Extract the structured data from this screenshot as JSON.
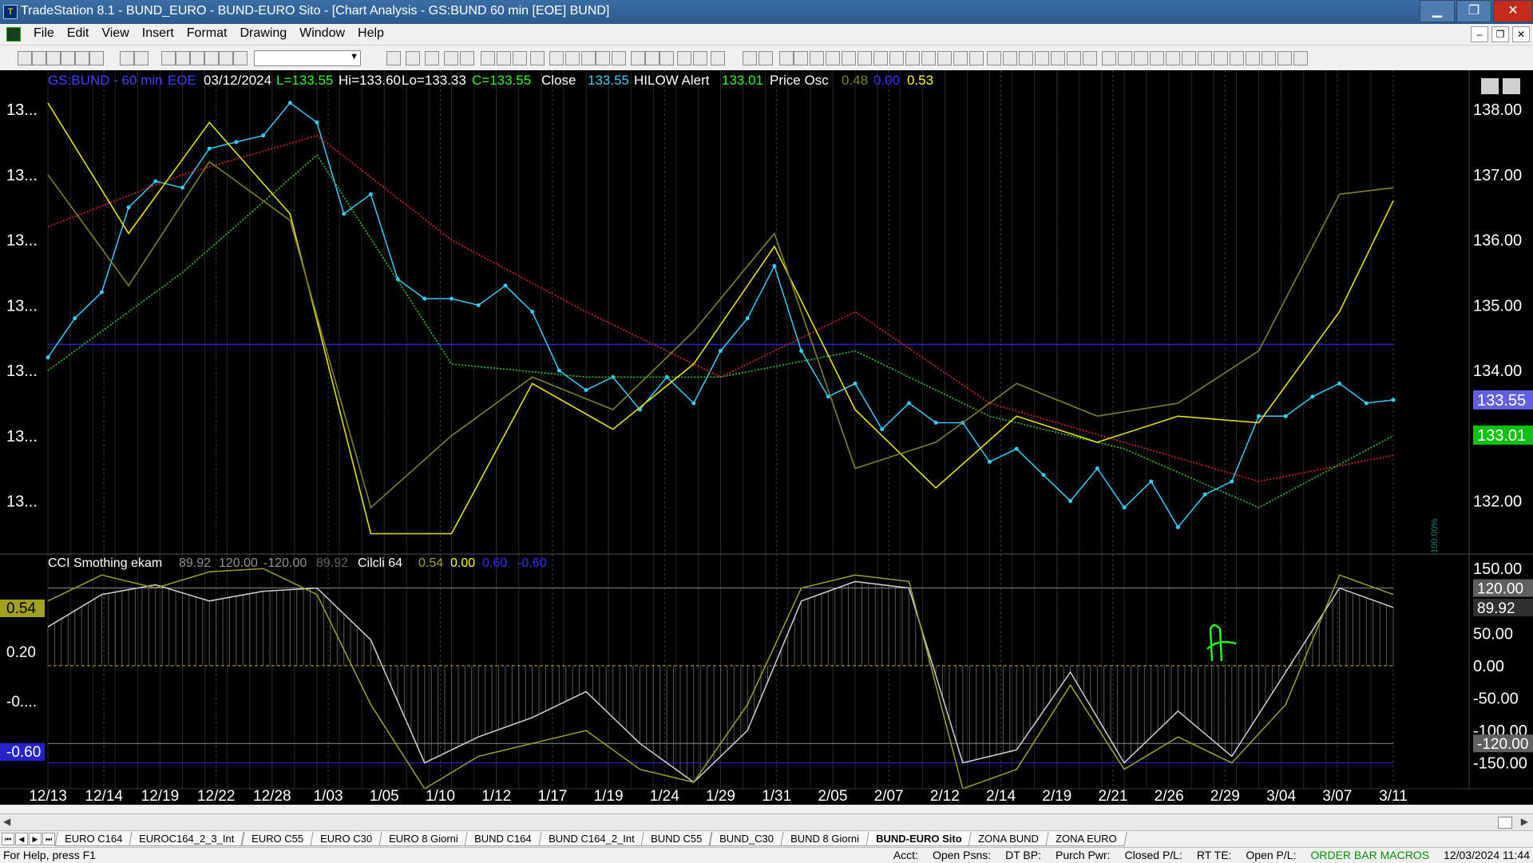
{
  "window": {
    "title": "TradeStation 8.1 - BUND_EURO - BUND-EURO Sito - [Chart Analysis - GS:BUND  60 min  [EOE] BUND]",
    "buttons": {
      "minimize": "▁",
      "restore": "❐",
      "close": "✕"
    }
  },
  "menu": [
    "File",
    "Edit",
    "View",
    "Insert",
    "Format",
    "Drawing",
    "Window",
    "Help"
  ],
  "mdi_buttons": {
    "minimize": "–",
    "restore": "❐",
    "close": "✕"
  },
  "chart_data": [
    {
      "type": "line",
      "name": "price-panel",
      "header": {
        "symbol": "GS:BUND - 60 min",
        "session": "EOE",
        "date": "03/12/2024",
        "last": "L=133.55",
        "high": "Hi=133.60",
        "low": "Lo=133.33",
        "close": "C=133.55",
        "close_label": "Close",
        "close_value": "133.55",
        "hilow_label": "HILOW Alert",
        "hilow_value": "133.01",
        "osc_label": "Price Osc",
        "osc_v1": "0.48",
        "osc_v2": "0.00",
        "osc_v3": "0.53"
      },
      "left_axis_labels": [
        "13...",
        "13...",
        "13...",
        "13...",
        "13...",
        "13...",
        "13..."
      ],
      "y_ticks": [
        138.0,
        137.0,
        136.0,
        135.0,
        134.0,
        133.0,
        132.0
      ],
      "y_tick_labels": [
        "138.00",
        "137.00",
        "136.00",
        "135.00",
        "134.00",
        "133.00",
        "132.00"
      ],
      "ylim": [
        131.2,
        138.6
      ],
      "price_tag": "133.55",
      "hilow_tag": "133.01",
      "percent_label": "100.00%",
      "horizontal_line": 134.4,
      "series": [
        {
          "name": "Close",
          "color": "#33ccff",
          "x": [
            0,
            2,
            4,
            6,
            8,
            10,
            12,
            14,
            16,
            18,
            20,
            22,
            24,
            26,
            28,
            30,
            32,
            34,
            36,
            38,
            40,
            42,
            44,
            46,
            48,
            50,
            52,
            54,
            56,
            58,
            60,
            62,
            64,
            66,
            68,
            70,
            72,
            74,
            76,
            78,
            80,
            82,
            84,
            86,
            88,
            90,
            92,
            94,
            96,
            98,
            100
          ],
          "values": [
            134.2,
            134.8,
            135.2,
            136.5,
            136.9,
            136.8,
            137.4,
            137.5,
            137.6,
            138.1,
            137.8,
            136.4,
            136.7,
            135.4,
            135.1,
            135.1,
            135.0,
            135.3,
            134.9,
            134.0,
            133.7,
            133.9,
            133.4,
            133.9,
            133.5,
            134.3,
            134.8,
            135.6,
            134.3,
            133.6,
            133.8,
            133.1,
            133.5,
            133.2,
            133.2,
            132.6,
            132.8,
            132.4,
            132.0,
            132.5,
            131.9,
            132.3,
            131.6,
            132.1,
            132.3,
            133.3,
            133.3,
            133.6,
            133.8,
            133.5,
            133.55
          ]
        },
        {
          "name": "MA-red",
          "color": "#e02020",
          "x": [
            0,
            10,
            20,
            30,
            40,
            50,
            60,
            70,
            80,
            90,
            100
          ],
          "values": [
            136.2,
            137.0,
            137.6,
            136.0,
            134.9,
            133.9,
            134.9,
            133.5,
            132.9,
            132.3,
            132.7
          ]
        },
        {
          "name": "MA-green",
          "color": "#22cc22",
          "x": [
            0,
            10,
            20,
            30,
            40,
            50,
            60,
            70,
            80,
            90,
            100
          ],
          "values": [
            134.0,
            135.5,
            137.3,
            134.1,
            133.9,
            133.9,
            134.3,
            133.3,
            132.8,
            131.9,
            133.0
          ]
        },
        {
          "name": "Osc-yellow",
          "color": "#e8e000",
          "x": [
            0,
            6,
            12,
            18,
            24,
            30,
            36,
            42,
            48,
            54,
            60,
            66,
            72,
            78,
            84,
            90,
            96,
            100
          ],
          "values": [
            138.1,
            136.1,
            137.8,
            136.4,
            131.5,
            131.5,
            133.8,
            133.1,
            134.1,
            135.9,
            133.4,
            132.2,
            133.3,
            132.9,
            133.3,
            133.2,
            134.9,
            136.6
          ]
        },
        {
          "name": "Osc-olive",
          "color": "#808020",
          "x": [
            0,
            6,
            12,
            18,
            24,
            30,
            36,
            42,
            48,
            54,
            60,
            66,
            72,
            78,
            84,
            90,
            96,
            100
          ],
          "values": [
            137.0,
            135.3,
            137.2,
            136.3,
            131.9,
            133.0,
            133.9,
            133.4,
            134.6,
            136.1,
            132.5,
            132.9,
            133.8,
            133.3,
            133.5,
            134.3,
            136.7,
            136.8
          ]
        }
      ]
    },
    {
      "type": "line",
      "name": "cci-panel",
      "header": {
        "name": "CCI Smothing ekam",
        "v1": "89.92",
        "v2": "120.00",
        "v3": "-120.00",
        "v4": "89.92",
        "cycles_label": "Cilcli 64",
        "c1": "0.54",
        "c2": "0.00",
        "c3": "0.60",
        "c4": "-0.60"
      },
      "left_axis_labels": [
        "0.54",
        "0.20",
        "-0....",
        "-0.60"
      ],
      "y_ticks": [
        150.0,
        50.0,
        0.0,
        -50.0,
        -100.0,
        -150.0
      ],
      "y_tick_labels": [
        "150.00",
        "50.00",
        "0.00",
        "-50.00",
        "-100.00",
        "-150.00"
      ],
      "ylim": [
        -190,
        170
      ],
      "tags": [
        "120.00",
        "89.92",
        "-120.00"
      ],
      "levels": [
        120,
        0,
        -120,
        -150
      ],
      "series": [
        {
          "name": "CCI",
          "color": "#d0d0d0",
          "x": [
            0,
            4,
            8,
            12,
            16,
            20,
            24,
            28,
            32,
            36,
            40,
            44,
            48,
            52,
            56,
            60,
            64,
            68,
            72,
            76,
            80,
            84,
            88,
            92,
            96,
            100
          ],
          "values": [
            60,
            110,
            125,
            100,
            115,
            120,
            40,
            -150,
            -110,
            -80,
            -40,
            -120,
            -180,
            -100,
            100,
            130,
            120,
            -150,
            -130,
            -10,
            -150,
            -70,
            -140,
            -10,
            120,
            90
          ]
        },
        {
          "name": "Signal",
          "color": "#a0a020",
          "x": [
            0,
            4,
            8,
            12,
            16,
            20,
            24,
            28,
            32,
            36,
            40,
            44,
            48,
            52,
            56,
            60,
            64,
            68,
            72,
            76,
            80,
            84,
            88,
            92,
            96,
            100
          ],
          "values": [
            100,
            140,
            120,
            145,
            150,
            110,
            -60,
            -190,
            -140,
            -120,
            -100,
            -160,
            -180,
            -60,
            120,
            140,
            130,
            -190,
            -160,
            -30,
            -160,
            -110,
            -150,
            -60,
            140,
            110
          ]
        }
      ]
    }
  ],
  "x_axis_labels": [
    "12/13",
    "12/14",
    "12/19",
    "12/22",
    "12/28",
    "1/03",
    "1/05",
    "1/10",
    "1/12",
    "1/17",
    "1/19",
    "1/24",
    "1/29",
    "1/31",
    "2/05",
    "2/07",
    "2/12",
    "2/14",
    "2/19",
    "2/21",
    "2/26",
    "2/29",
    "3/04",
    "3/07",
    "3/11"
  ],
  "tabs": [
    "EURO C164",
    "EUROC164_2_3_Int",
    "EURO C55",
    "EURO C30",
    "EURO 8 Giorni",
    "BUND C164",
    "BUND C164_2_Int",
    "BUND C55",
    "BUND_C30",
    "BUND 8 Giorni",
    "BUND-EURO Sito",
    "ZONA BUND",
    "ZONA EURO"
  ],
  "active_tab": "BUND-EURO Sito",
  "status": {
    "help": "For Help, press F1",
    "acct": "Acct:",
    "open_psns": "Open Psns:",
    "dt_bp": "DT BP:",
    "purch_pwr": "Purch Pwr:",
    "closed_pl": "Closed P/L:",
    "rt_te": "RT TE:",
    "open_pl": "Open P/L:",
    "mode": "ORDER BAR  MACROS",
    "datetime": "12/03/2024 11:44"
  },
  "colors": {
    "chart_bg": "#000000",
    "grid": "#3a3a3a",
    "axis_text": "#ffffff"
  }
}
